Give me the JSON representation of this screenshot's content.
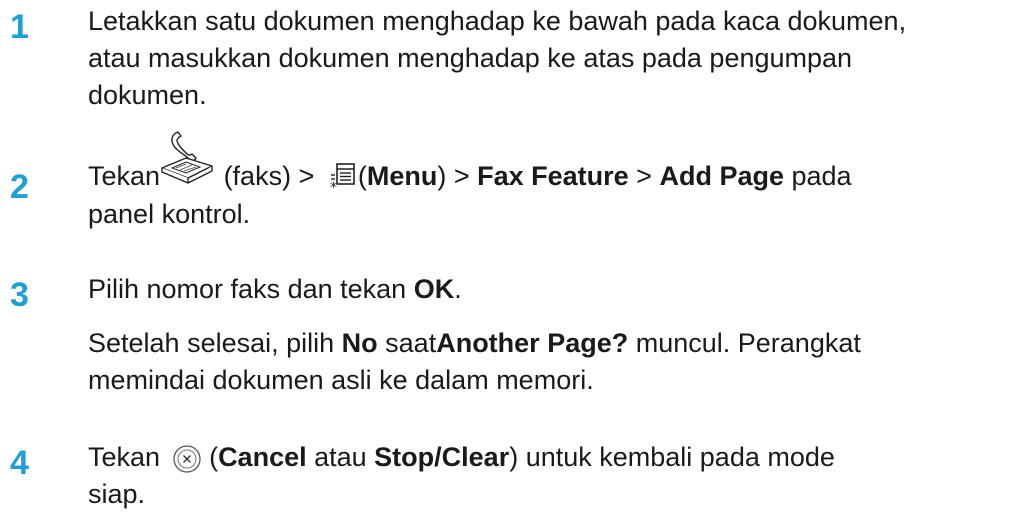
{
  "steps": [
    {
      "number": "1",
      "line1": "Letakkan satu dokumen menghadap ke bawah pada kaca dokumen,",
      "line2": "atau masukkan dokumen menghadap ke atas pada pengumpan",
      "line3": "dokumen."
    },
    {
      "number": "2",
      "tekan": "Tekan",
      "faks": " (faks) > ",
      "menu_open": "(",
      "menu": "Menu",
      "menu_close": ") > ",
      "fax_feature": "Fax Feature",
      "sep": " > ",
      "add_page": "Add Page",
      "pada": " pada",
      "line2": "panel kontrol."
    },
    {
      "number": "3",
      "pre": "Pilih nomor faks dan tekan ",
      "ok": "OK",
      "dot": ".",
      "sub_pre": "Setelah selesai, pilih ",
      "no": "No",
      "saat": " saat",
      "another": "Another Page?",
      "sub_post": " muncul. Perangkat",
      "sub_line2": "memindai dokumen asli ke dalam memori."
    },
    {
      "number": "4",
      "tekan": "Tekan ",
      "open": " (",
      "cancel": "Cancel",
      "atau": " atau ",
      "stop_clear": "Stop/Clear",
      "post": ") untuk kembali pada mode",
      "line2": "siap."
    }
  ],
  "icons": {
    "fax": "fax-icon",
    "menu": "menu-icon",
    "cancel": "cancel-icon"
  },
  "colors": {
    "step_number": "#1f9fd6",
    "text": "#1a1a1a"
  }
}
